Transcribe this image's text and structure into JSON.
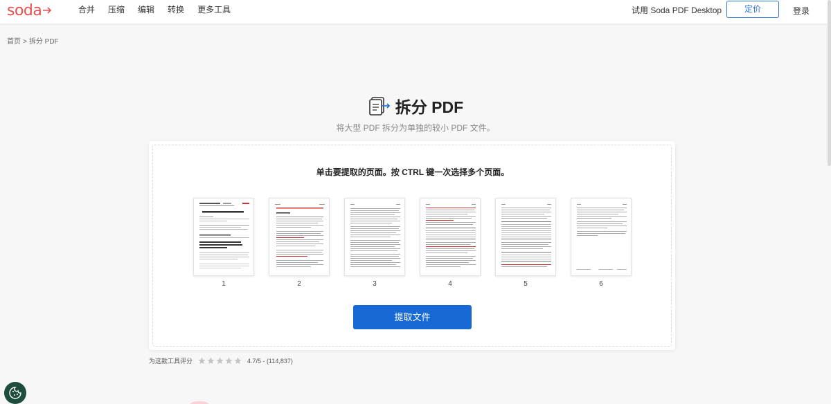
{
  "brand": {
    "logo_text": "soda",
    "accent": "#e8504f",
    "primary": "#1769d6"
  },
  "nav": {
    "items": [
      "合并",
      "压缩",
      "编辑",
      "转换",
      "更多工具"
    ]
  },
  "header": {
    "try_desktop": "试用 Soda PDF Desktop",
    "pricing": "定价",
    "login": "登录"
  },
  "breadcrumb": {
    "home": "首页",
    "separator": ">",
    "current": "拆分 PDF"
  },
  "tool": {
    "icon": "split-pdf-icon",
    "title": "拆分 PDF",
    "subtitle": "将大型 PDF 拆分为单独的较小 PDF 文件。",
    "instruction": "单击要提取的页面。按 CTRL 键一次选择多个页面。",
    "pages": [
      "1",
      "2",
      "3",
      "4",
      "5",
      "6"
    ],
    "extract_button": "提取文件"
  },
  "rating": {
    "label": "为这款工具评分",
    "stars": 5,
    "score_text": "4.7/5 - (114,837)"
  }
}
